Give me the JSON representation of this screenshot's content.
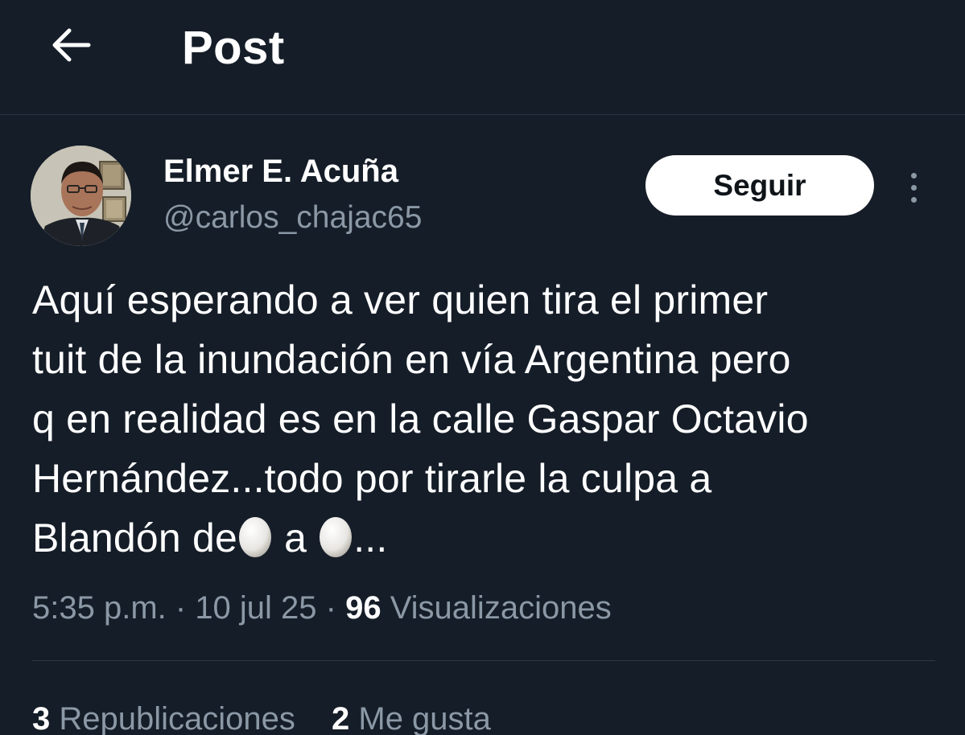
{
  "header": {
    "title": "Post",
    "back_icon": "arrow-left-icon"
  },
  "author": {
    "name": "Elmer E. Acuña",
    "handle": "@carlos_chajac65",
    "follow_label": "Seguir",
    "more_icon": "more-vertical-icon"
  },
  "tweet": {
    "lines": [
      "Aquí esperando a ver quien tira el primer",
      "tuit de la inundación en vía Argentina pero",
      "q en realidad es en la calle Gaspar Octavio",
      "Hernández...todo por tirarle la culpa a"
    ],
    "last_line_part1": "Blandón de",
    "last_line_part2": " a ",
    "last_line_part3": "...",
    "emoji": "egg-icon"
  },
  "meta": {
    "time": "5:35 p.m.",
    "separator": " · ",
    "date": "10 jul 25",
    "views_count": "96",
    "views_label": " Visualizaciones"
  },
  "stats": {
    "reposts_count": "3",
    "reposts_label": " Republicaciones",
    "likes_count": "2",
    "likes_label": " Me gusta"
  },
  "colors": {
    "background": "#151d28",
    "secondary_text": "#8b98a5",
    "primary_text": "#ffffff",
    "follow_button_bg": "#ffffff"
  }
}
